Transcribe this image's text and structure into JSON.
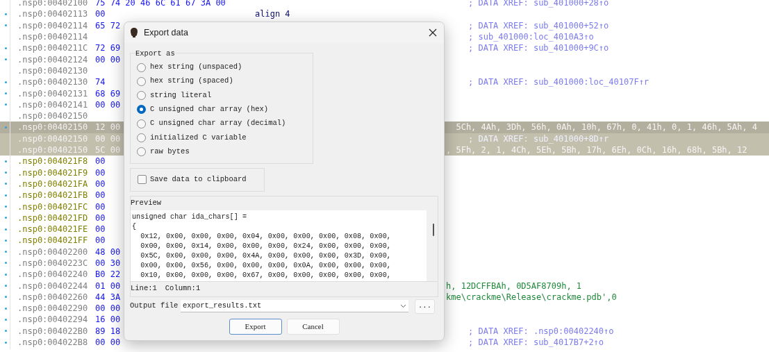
{
  "listing": {
    "rows": [
      {
        "address": ".nsp0:00402100",
        "bytes": "75 74 20 46 6C 61 67 3A 00",
        "comment": "; DATA XREF: sub_401000+28↑o",
        "marked": false,
        "selected": false,
        "kind": "defined"
      },
      {
        "address": ".nsp0:00402113",
        "bytes": "00",
        "instruction": "align 4",
        "marked": true,
        "selected": false,
        "kind": "defined"
      },
      {
        "address": ".nsp0:00402114",
        "bytes": "65 72",
        "comment": "; DATA XREF: sub_401000+52↑o",
        "marked": true,
        "selected": false,
        "kind": "defined"
      },
      {
        "address": ".nsp0:00402114",
        "comment": "; sub_401000:loc_4010A3↑o",
        "marked": false,
        "selected": false,
        "kind": "defined"
      },
      {
        "address": ".nsp0:0040211C",
        "bytes": "72 69",
        "comment": "; DATA XREF: sub_401000+9C↑o",
        "marked": true,
        "selected": false,
        "kind": "defined"
      },
      {
        "address": ".nsp0:00402124",
        "bytes": "00 00",
        "marked": true,
        "selected": false,
        "kind": "defined"
      },
      {
        "address": ".nsp0:00402130",
        "marked": false,
        "selected": false,
        "kind": "defined"
      },
      {
        "address": ".nsp0:00402130",
        "bytes": "74",
        "comment": "; DATA XREF: sub_401000:loc_40107F↑r",
        "marked": true,
        "selected": false,
        "kind": "defined"
      },
      {
        "address": ".nsp0:00402131",
        "bytes": "68 69",
        "marked": true,
        "selected": false,
        "kind": "defined"
      },
      {
        "address": ".nsp0:00402141",
        "bytes": "00 00",
        "marked": true,
        "selected": false,
        "kind": "defined"
      },
      {
        "address": ".nsp0:00402150",
        "marked": false,
        "selected": false,
        "kind": "defined"
      },
      {
        "address": ".nsp0:00402150",
        "bytes": "12 00",
        "tail": "  5Ch, 4Ah, 3Dh, 56h, 0Ah, 10h, 67h, 0, 41h, 0, 1, 46h, 5Ah, 4",
        "marked": true,
        "selected": true,
        "kind": "defined"
      },
      {
        "address": ".nsp0:00402150",
        "bytes": "00 00",
        "comment": "; DATA XREF: sub_401000+8D↑r",
        "marked": false,
        "selected": true,
        "kind": "defined"
      },
      {
        "address": ".nsp0:00402150",
        "bytes": "5C 00",
        "tail": ", 5Fh, 2, 1, 4Ch, 5Eh, 5Bh, 17h, 6Eh, 0Ch, 16h, 68h, 5Bh, 12",
        "marked": false,
        "selected": true,
        "kind": "defined"
      },
      {
        "address": ".nsp0:004021F8",
        "bytes": "00",
        "marked": true,
        "selected": false,
        "kind": "unexplored"
      },
      {
        "address": ".nsp0:004021F9",
        "bytes": "00",
        "marked": true,
        "selected": false,
        "kind": "unexplored"
      },
      {
        "address": ".nsp0:004021FA",
        "bytes": "00",
        "marked": true,
        "selected": false,
        "kind": "unexplored"
      },
      {
        "address": ".nsp0:004021FB",
        "bytes": "00",
        "marked": true,
        "selected": false,
        "kind": "unexplored"
      },
      {
        "address": ".nsp0:004021FC",
        "bytes": "00",
        "marked": true,
        "selected": false,
        "kind": "unexplored"
      },
      {
        "address": ".nsp0:004021FD",
        "bytes": "00",
        "marked": true,
        "selected": false,
        "kind": "unexplored"
      },
      {
        "address": ".nsp0:004021FE",
        "bytes": "00",
        "marked": true,
        "selected": false,
        "kind": "unexplored"
      },
      {
        "address": ".nsp0:004021FF",
        "bytes": "00",
        "marked": true,
        "selected": false,
        "kind": "unexplored"
      },
      {
        "address": ".nsp0:00402200",
        "bytes": "48 00",
        "marked": true,
        "selected": false,
        "kind": "defined"
      },
      {
        "address": ".nsp0:0040223C",
        "bytes": "00 30",
        "marked": true,
        "selected": false,
        "kind": "defined"
      },
      {
        "address": ".nsp0:00402240",
        "bytes": "B0 22",
        "marked": true,
        "selected": false,
        "kind": "defined"
      },
      {
        "address": ".nsp0:00402244",
        "bytes": "01 00",
        "tail": "h, 12DCFFBAh, 0D5AF8709h, 1",
        "marked": true,
        "selected": false,
        "kind": "defined"
      },
      {
        "address": ".nsp0:00402260",
        "bytes": "44 3A",
        "tail": "kme\\crackme\\Release\\crackme.pdb',0",
        "marked": true,
        "selected": false,
        "kind": "defined"
      },
      {
        "address": ".nsp0:00402290",
        "bytes": "00 00",
        "marked": true,
        "selected": false,
        "kind": "defined"
      },
      {
        "address": ".nsp0:00402294",
        "bytes": "16 00",
        "marked": true,
        "selected": false,
        "kind": "defined"
      },
      {
        "address": ".nsp0:004022B0",
        "bytes": "89 18",
        "comment": "; DATA XREF: .nsp0:00402240↑o",
        "marked": true,
        "selected": false,
        "kind": "defined"
      },
      {
        "address": ".nsp0:004022B8",
        "bytes": "00 00",
        "comment": "; DATA XREF: sub_4017B7+2↑o",
        "marked": true,
        "selected": false,
        "kind": "defined"
      }
    ]
  },
  "dialog": {
    "title": "Export data",
    "export_as": {
      "legend": "Export as",
      "options": [
        {
          "label": "hex string (unspaced)",
          "selected": false
        },
        {
          "label": "hex string (spaced)",
          "selected": false
        },
        {
          "label": "string literal",
          "selected": false
        },
        {
          "label": "C unsigned char array (hex)",
          "selected": true
        },
        {
          "label": "C unsigned char array (decimal)",
          "selected": false
        },
        {
          "label": "initialized C variable",
          "selected": false
        },
        {
          "label": "raw bytes",
          "selected": false
        }
      ]
    },
    "save_to_clipboard": {
      "label": "Save data to clipboard",
      "checked": false
    },
    "preview": {
      "label": "Preview",
      "lines": [
        "unsigned char ida_chars[] =",
        "{",
        "  0x12, 0x00, 0x00, 0x00, 0x04, 0x00, 0x00, 0x00, 0x08, 0x00,",
        "  0x00, 0x00, 0x14, 0x00, 0x00, 0x00, 0x24, 0x00, 0x00, 0x00,",
        "  0x5C, 0x00, 0x00, 0x00, 0x4A, 0x00, 0x00, 0x00, 0x3D, 0x00,",
        "  0x00, 0x00, 0x56, 0x00, 0x00, 0x00, 0x0A, 0x00, 0x00, 0x00,",
        "  0x10, 0x00, 0x00, 0x00, 0x67, 0x00, 0x00, 0x00, 0x00, 0x00,"
      ]
    },
    "cursor": [
      "Line:1",
      "Column:1"
    ],
    "output_file": {
      "label": "Output file",
      "value": "export_results.txt"
    },
    "browse_button": "...",
    "buttons": [
      {
        "label": "Export",
        "default": true
      },
      {
        "label": "Cancel",
        "default": false
      }
    ]
  }
}
